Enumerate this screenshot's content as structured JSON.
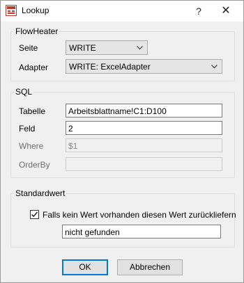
{
  "window": {
    "title": "Lookup",
    "help_label": "?",
    "close_label": "✕"
  },
  "flowheater": {
    "group_title": "FlowHeater",
    "seite_label": "Seite",
    "seite_value": "WRITE",
    "adapter_label": "Adapter",
    "adapter_value": "WRITE: ExcelAdapter"
  },
  "sql": {
    "group_title": "SQL",
    "tabelle_label": "Tabelle",
    "tabelle_value": "Arbeitsblattname!C1:D100",
    "feld_label": "Feld",
    "feld_value": "2",
    "where_label": "Where",
    "where_value": "$1",
    "orderby_label": "OrderBy",
    "orderby_value": ""
  },
  "standardwert": {
    "group_title": "Standardwert",
    "checkbox_label": "Falls kein Wert vorhanden diesen Wert zurückliefern",
    "checkbox_checked": true,
    "value": "nicht gefunden"
  },
  "buttons": {
    "ok_label": "OK",
    "cancel_label": "Abbrechen"
  }
}
